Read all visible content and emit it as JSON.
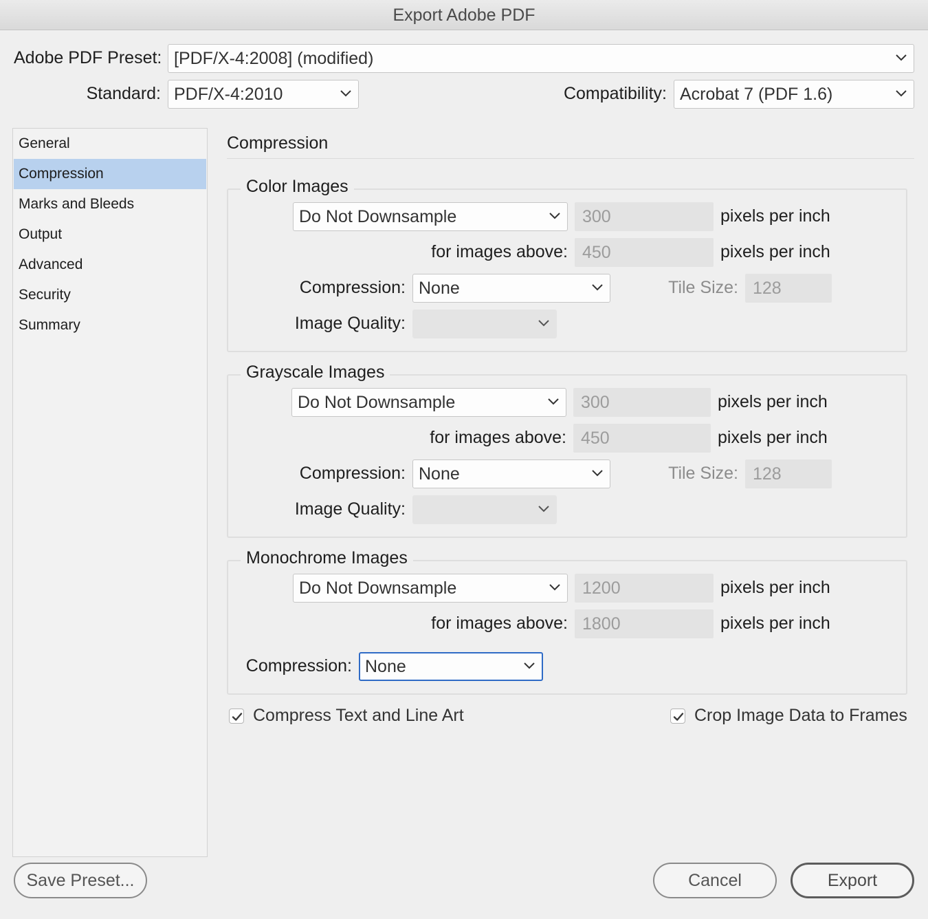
{
  "window": {
    "title": "Export Adobe PDF"
  },
  "header": {
    "preset_label": "Adobe PDF Preset:",
    "preset_value": "[PDF/X-4:2008] (modified)",
    "standard_label": "Standard:",
    "standard_value": "PDF/X-4:2010",
    "compatibility_label": "Compatibility:",
    "compatibility_value": "Acrobat 7 (PDF 1.6)"
  },
  "sidebar": {
    "selected": "Compression",
    "items": [
      {
        "label": "General"
      },
      {
        "label": "Compression"
      },
      {
        "label": "Marks and Bleeds"
      },
      {
        "label": "Output"
      },
      {
        "label": "Advanced"
      },
      {
        "label": "Security"
      },
      {
        "label": "Summary"
      }
    ]
  },
  "main": {
    "title": "Compression",
    "color_images": {
      "legend": "Color Images",
      "downsample_value": "Do Not Downsample",
      "ppi_value": "300",
      "ppi_unit": "pixels per inch",
      "above_label": "for images above:",
      "above_value": "450",
      "above_unit": "pixels per inch",
      "compression_label": "Compression:",
      "compression_value": "None",
      "tile_label": "Tile Size:",
      "tile_value": "128",
      "quality_label": "Image Quality:",
      "quality_value": ""
    },
    "grayscale_images": {
      "legend": "Grayscale Images",
      "downsample_value": "Do Not Downsample",
      "ppi_value": "300",
      "ppi_unit": "pixels per inch",
      "above_label": "for images above:",
      "above_value": "450",
      "above_unit": "pixels per inch",
      "compression_label": "Compression:",
      "compression_value": "None",
      "tile_label": "Tile Size:",
      "tile_value": "128",
      "quality_label": "Image Quality:",
      "quality_value": ""
    },
    "monochrome_images": {
      "legend": "Monochrome Images",
      "downsample_value": "Do Not Downsample",
      "ppi_value": "1200",
      "ppi_unit": "pixels per inch",
      "above_label": "for images above:",
      "above_value": "1800",
      "above_unit": "pixels per inch",
      "compression_label": "Compression:",
      "compression_value": "None"
    },
    "options": {
      "compress_text_label": "Compress Text and Line Art",
      "compress_text_checked": true,
      "crop_image_label": "Crop Image Data to Frames",
      "crop_image_checked": true
    }
  },
  "footer": {
    "save_preset_label": "Save Preset...",
    "cancel_label": "Cancel",
    "export_label": "Export"
  },
  "colors": {
    "accent": "#2f6bc6",
    "selection": "#b8d1ee",
    "background": "#efefef"
  }
}
